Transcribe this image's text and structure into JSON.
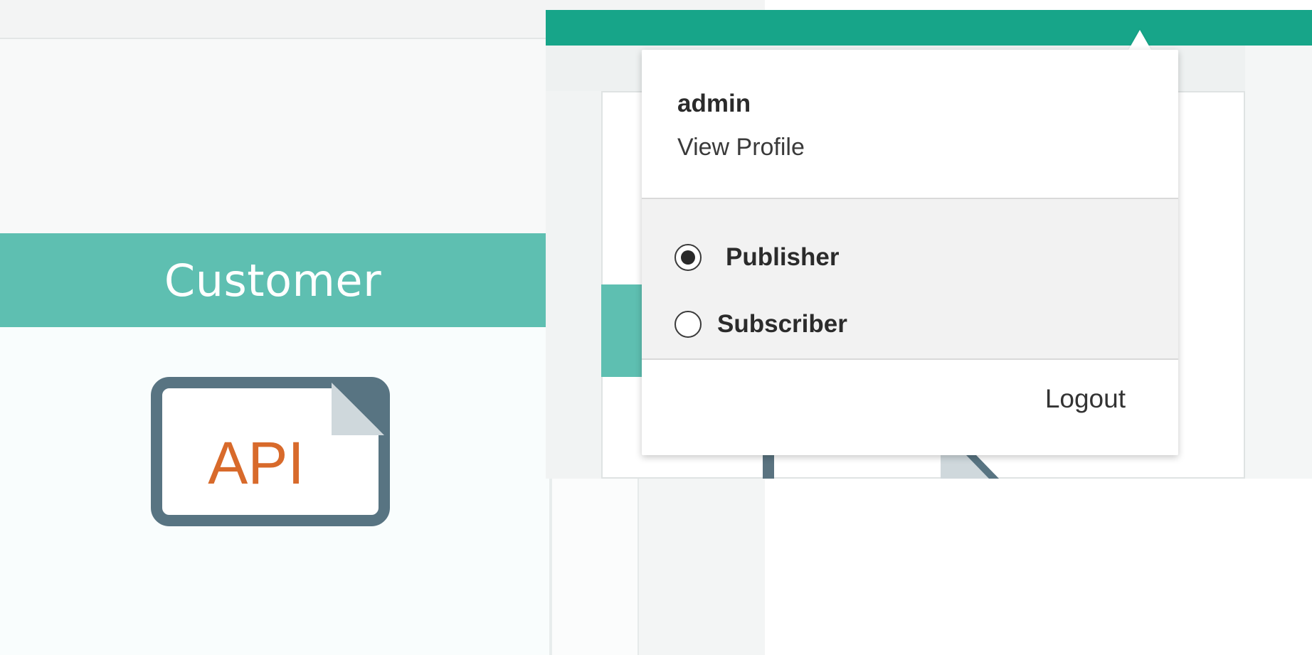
{
  "left_panel": {
    "banner_label": "Customer",
    "api_icon": {
      "name": "api-document-icon",
      "label": "API"
    }
  },
  "user_menu": {
    "username": "admin",
    "view_profile_label": "View Profile",
    "roles": [
      {
        "label": "Publisher",
        "selected": true
      },
      {
        "label": "Subscriber",
        "selected": false
      }
    ],
    "logout_label": "Logout"
  },
  "colors": {
    "header_teal": "#17a589",
    "banner_teal": "#5ebfb1",
    "api_text_orange": "#d86a2b",
    "api_icon_slate": "#587482"
  }
}
